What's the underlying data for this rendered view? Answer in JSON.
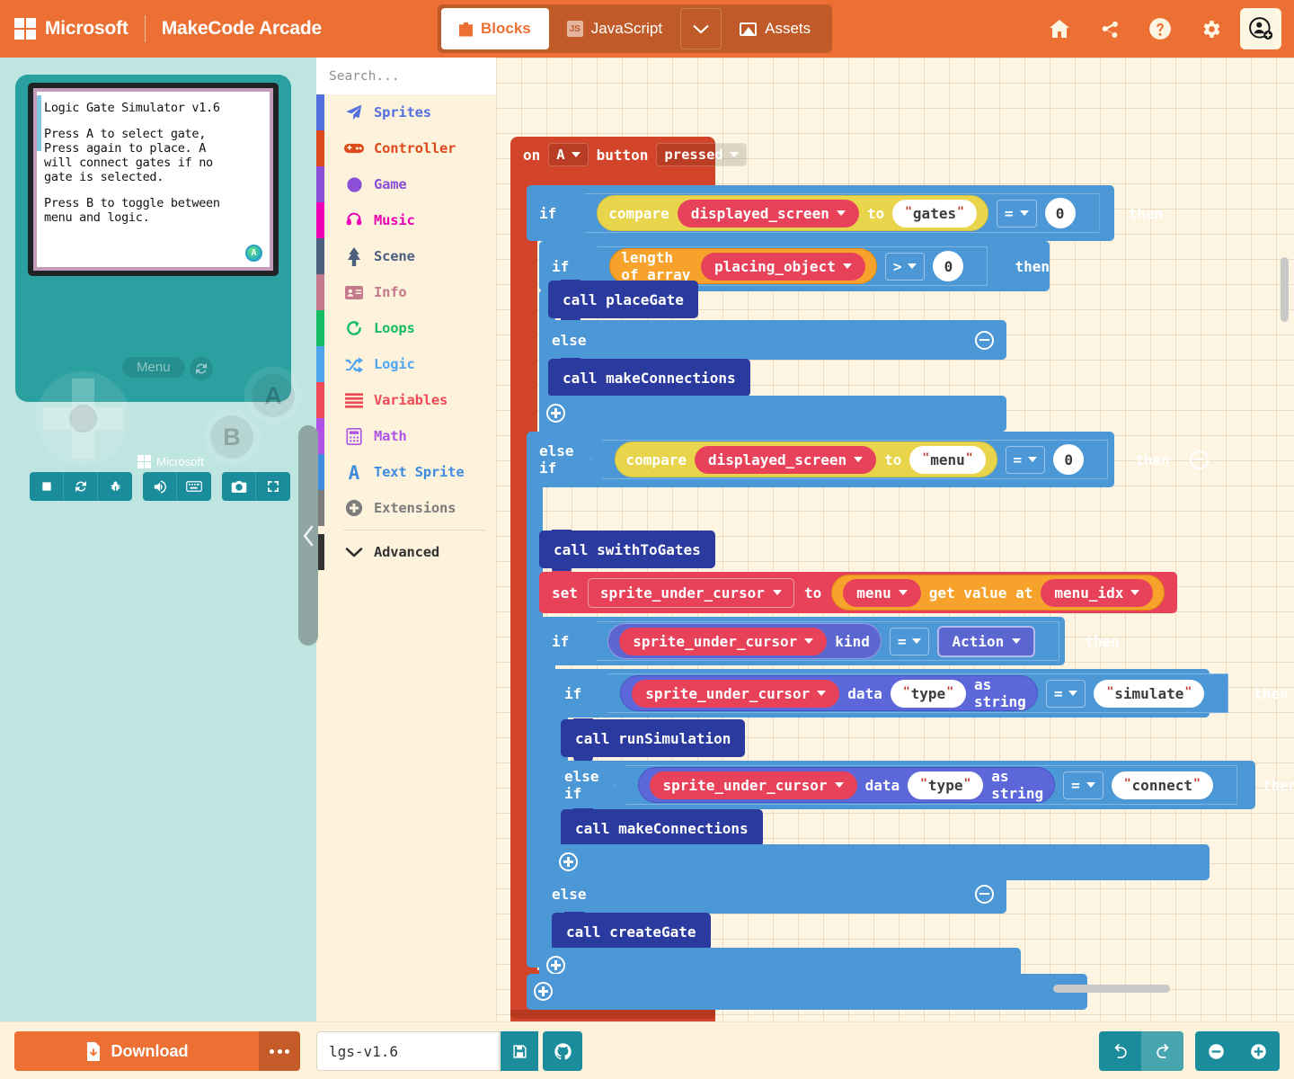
{
  "header": {
    "brand_microsoft": "Microsoft",
    "brand_app": "MakeCode Arcade",
    "tabs": [
      {
        "label": "Blocks",
        "icon": "puzzle-icon",
        "active": true
      },
      {
        "label": "JavaScript",
        "icon": "js-icon",
        "active": false
      },
      {
        "label": "Assets",
        "icon": "image-icon",
        "active": false
      }
    ],
    "actions": [
      {
        "name": "home-icon"
      },
      {
        "name": "share-icon"
      },
      {
        "name": "help-icon"
      },
      {
        "name": "settings-gear-icon"
      },
      {
        "name": "account-icon"
      }
    ]
  },
  "simulator": {
    "screen_lines": [
      "Logic Gate Simulator v1.6",
      "Press A to select gate,\nPress again to place. A\nwill connect gates if no\ngate is selected.",
      "Press B to toggle between\nmenu and logic."
    ],
    "badge_letter": "A",
    "menu_label": "Menu",
    "refresh_icon": "refresh-icon",
    "button_a": "A",
    "button_b": "B",
    "brand_label": "Microsoft",
    "toolbar": [
      {
        "name": "stop-icon"
      },
      {
        "name": "restart-icon"
      },
      {
        "name": "debug-bug-icon"
      },
      {
        "name": "volume-icon"
      },
      {
        "name": "keyboard-icon"
      },
      {
        "name": "screenshot-camera-icon"
      },
      {
        "name": "fullscreen-icon"
      }
    ]
  },
  "toolbox": {
    "search_placeholder": "Search...",
    "categories": [
      {
        "label": "Sprites",
        "color": "#5270E0",
        "icon": "paper-plane-icon"
      },
      {
        "label": "Controller",
        "color": "#DC4A1B",
        "icon": "gamepad-icon"
      },
      {
        "label": "Game",
        "color": "#8A4FD6",
        "icon": "circle-icon"
      },
      {
        "label": "Music",
        "color": "#ED00B5",
        "icon": "headphones-icon"
      },
      {
        "label": "Scene",
        "color": "#4C5F7F",
        "icon": "tree-icon"
      },
      {
        "label": "Info",
        "color": "#C4798C",
        "icon": "id-card-icon"
      },
      {
        "label": "Loops",
        "color": "#15BD62",
        "icon": "loop-arrow-icon"
      },
      {
        "label": "Logic",
        "color": "#50A5EF",
        "icon": "shuffle-icon"
      },
      {
        "label": "Variables",
        "color": "#EE4B57",
        "icon": "list-lines-icon"
      },
      {
        "label": "Math",
        "color": "#B054E8",
        "icon": "calculator-icon"
      },
      {
        "label": "Text Sprite",
        "color": "#3E8CE0",
        "icon": "letter-a-icon"
      },
      {
        "label": "Extensions",
        "color": "#7C7C7C",
        "icon": "plus-circle-icon"
      }
    ],
    "advanced": {
      "label": "Advanced",
      "color": "#333333",
      "icon": "chevron-down-icon"
    }
  },
  "workspace": {
    "event_block": {
      "on": "on",
      "button_var": "A",
      "button": "button",
      "state": "pressed"
    },
    "if1": {
      "keyword": "if",
      "compare": "compare",
      "variable": "displayed_screen",
      "to": "to",
      "string": "gates",
      "op": "=",
      "num": "0",
      "then": "then"
    },
    "if2": {
      "keyword": "if",
      "length_of_array": "length of array",
      "variable": "placing_object",
      "op": ">",
      "num": "0",
      "then": "then"
    },
    "call_place_gate": "call placeGate",
    "else1": "else",
    "call_make_connections_1": "call makeConnections",
    "elseif1": {
      "keyword": "else if",
      "compare": "compare",
      "variable": "displayed_screen",
      "to": "to",
      "string": "menu",
      "op": "=",
      "num": "0",
      "then": "then"
    },
    "call_swith_to_gates": "call swithToGates",
    "set_block": {
      "set": "set",
      "variable": "sprite_under_cursor",
      "to": "to",
      "array": "menu",
      "get_value_at": "get value at",
      "index": "menu_idx"
    },
    "if3": {
      "keyword": "if",
      "variable": "sprite_under_cursor",
      "kind": "kind",
      "op": "=",
      "kind_value": "Action",
      "then": "then"
    },
    "if4": {
      "keyword": "if",
      "variable": "sprite_under_cursor",
      "data": "data",
      "key": "type",
      "as_string": "as string",
      "op": "=",
      "string": "simulate",
      "then": "then"
    },
    "call_run_simulation": "call runSimulation",
    "elseif2": {
      "keyword": "else if",
      "variable": "sprite_under_cursor",
      "data": "data",
      "key": "type",
      "as_string": "as string",
      "op": "=",
      "string": "connect",
      "then": "then"
    },
    "call_make_connections_2": "call makeConnections",
    "else2": "else",
    "call_create_gate": "call createGate"
  },
  "footer": {
    "download_label": "Download",
    "download_icon": "download-file-icon",
    "more_label": "more-options",
    "project_name": "lgs-v1.6",
    "save_icon": "floppy-save-icon",
    "github_icon": "github-icon",
    "undo_icon": "undo-arrow-icon",
    "redo_icon": "redo-arrow-icon",
    "zoom_out_icon": "zoom-out-icon",
    "zoom_in_icon": "zoom-in-icon"
  },
  "colors": {
    "brand_orange": "#EC7033",
    "teal": "#1B8C9C",
    "workspace_bg": "#FDF4E1",
    "control_blue": "#4C97D6",
    "event_red": "#D3452A"
  }
}
